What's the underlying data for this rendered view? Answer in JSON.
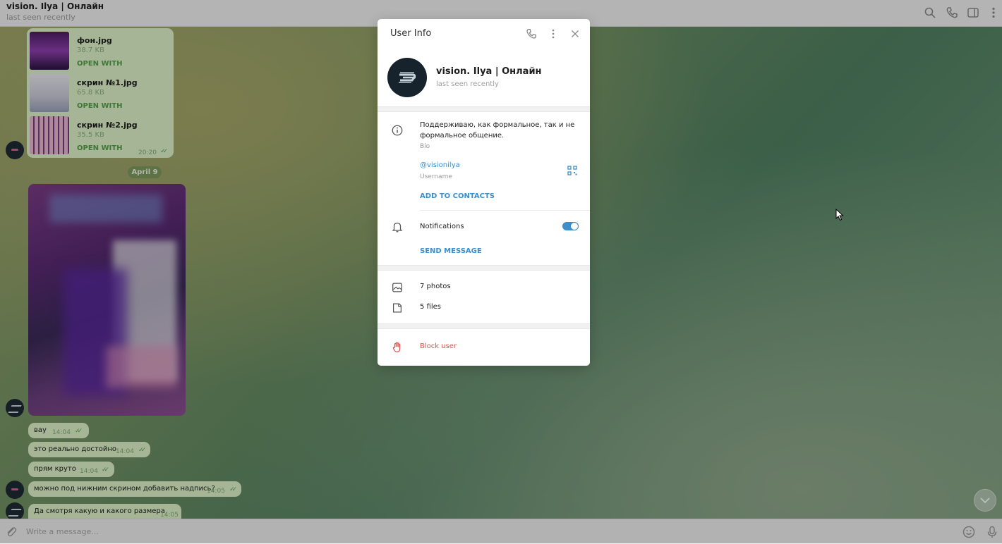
{
  "header": {
    "title": "vision. Ilya | Онлайн",
    "status": "last seen recently"
  },
  "files": [
    {
      "name": "фон.jpg",
      "size": "38.7 KB",
      "action": "OPEN WITH"
    },
    {
      "name": "скрин №1.jpg",
      "size": "65.8 KB",
      "action": "OPEN WITH"
    },
    {
      "name": "скрин №2.jpg",
      "size": "35.5 KB",
      "action": "OPEN WITH"
    }
  ],
  "files_time": "20:20",
  "date_separator": "April 9",
  "messages": [
    {
      "text": "вау",
      "time": "14:04"
    },
    {
      "text": "это реально достойно",
      "time": "14:04"
    },
    {
      "text": "прям круто",
      "time": "14:04"
    },
    {
      "text": "можно под нижним скрином добавить надпись?",
      "time": "14:05"
    },
    {
      "text": "Да смотря какую и какого размера",
      "time": "14:05"
    }
  ],
  "composer": {
    "placeholder": "Write a message..."
  },
  "modal": {
    "title": "User Info",
    "name": "vision. Ilya | Онлайн",
    "status": "last seen recently",
    "bio": "Поддерживаю, как формальное, так и не формальное общение.",
    "bio_label": "Bio",
    "username": "@visionilya",
    "username_label": "Username",
    "add_contact": "ADD TO CONTACTS",
    "notifications_label": "Notifications",
    "notifications_on": true,
    "send_message": "SEND MESSAGE",
    "photos": "7 photos",
    "files": "5 files",
    "block": "Block user"
  },
  "colors": {
    "accent": "#3a8fcc",
    "bubble": "#dcf2c7",
    "danger": "#d9534f"
  }
}
